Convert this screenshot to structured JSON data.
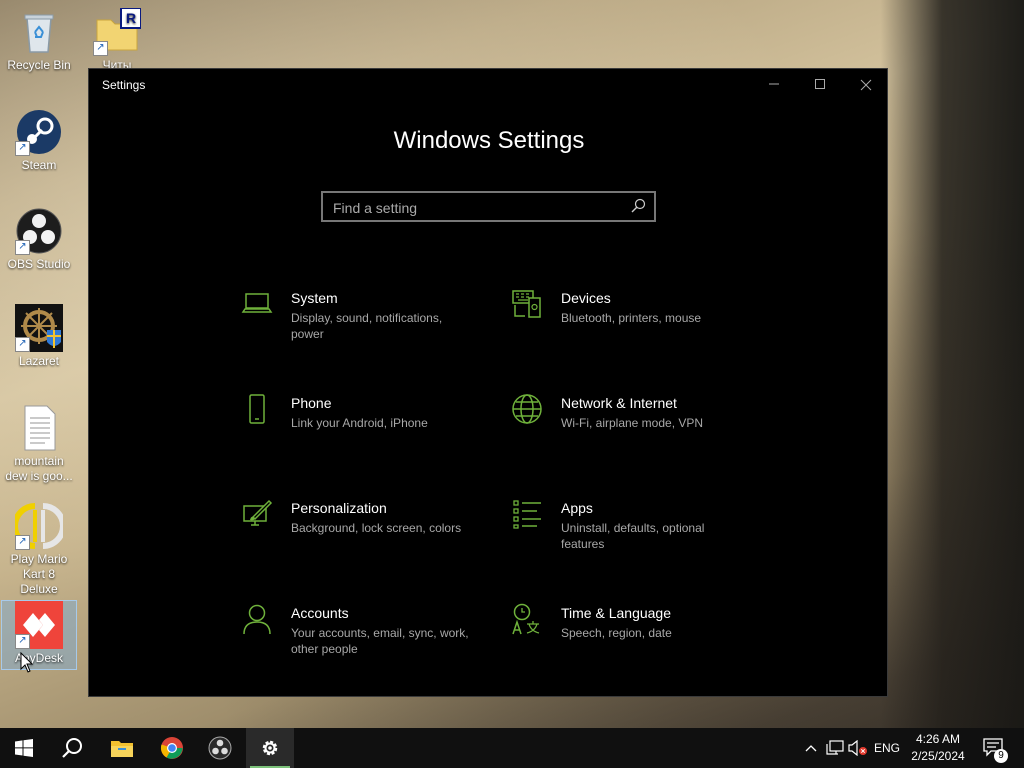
{
  "desktop": {
    "icons": [
      {
        "label": "Recycle Bin"
      },
      {
        "label": "Читы"
      },
      {
        "label": "Steam"
      },
      {
        "label": "OBS Studio"
      },
      {
        "label": "Lazaret"
      },
      {
        "label": "mountain dew is goo..."
      },
      {
        "label": "Play Mario Kart 8 Deluxe"
      },
      {
        "label": "AnyDesk"
      }
    ]
  },
  "window": {
    "title": "Settings",
    "heading": "Windows Settings",
    "search_placeholder": "Find a setting",
    "accent_color": "#6fb13b",
    "categories": [
      {
        "title": "System",
        "desc": "Display, sound, notifications, power",
        "icon": "laptop-icon"
      },
      {
        "title": "Devices",
        "desc": "Bluetooth, printers, mouse",
        "icon": "devices-icon"
      },
      {
        "title": "Phone",
        "desc": "Link your Android, iPhone",
        "icon": "phone-icon"
      },
      {
        "title": "Network & Internet",
        "desc": "Wi-Fi, airplane mode, VPN",
        "icon": "globe-icon"
      },
      {
        "title": "Personalization",
        "desc": "Background, lock screen, colors",
        "icon": "paint-icon"
      },
      {
        "title": "Apps",
        "desc": "Uninstall, defaults, optional features",
        "icon": "apps-list-icon"
      },
      {
        "title": "Accounts",
        "desc": "Your accounts, email, sync, work, other people",
        "icon": "person-icon"
      },
      {
        "title": "Time & Language",
        "desc": "Speech, region, date",
        "icon": "time-language-icon"
      }
    ]
  },
  "taskbar": {
    "language": "ENG",
    "time": "4:26 AM",
    "date": "2/25/2024",
    "notification_count": "9",
    "pinned": [
      "start-icon",
      "search-icon",
      "file-explorer-icon",
      "chrome-icon",
      "obs-icon",
      "settings-icon"
    ]
  }
}
